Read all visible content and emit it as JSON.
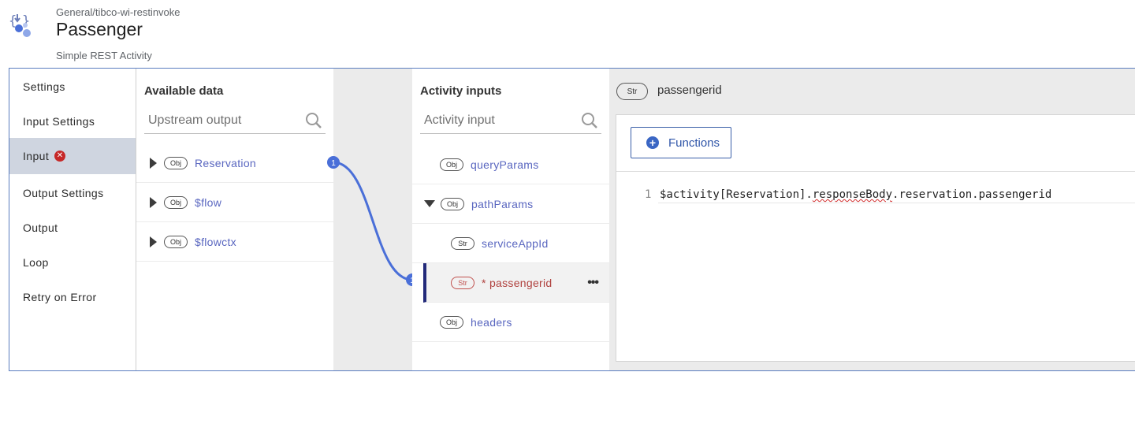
{
  "header": {
    "breadcrumb": "General/tibco-wi-restinvoke",
    "title": "Passenger",
    "subtitle": "Simple REST Activity"
  },
  "nav": {
    "items": [
      {
        "label": "Settings"
      },
      {
        "label": "Input Settings"
      },
      {
        "label": "Input",
        "has_error": true,
        "error_symbol": "✕"
      },
      {
        "label": "Output Settings"
      },
      {
        "label": "Output"
      },
      {
        "label": "Loop"
      },
      {
        "label": "Retry on Error"
      }
    ]
  },
  "available": {
    "title": "Available data",
    "search_placeholder": "Upstream output",
    "items": [
      {
        "type": "Obj",
        "label": "Reservation",
        "expandable": true
      },
      {
        "type": "Obj",
        "label": "$flow",
        "expandable": true
      },
      {
        "type": "Obj",
        "label": "$flowctx",
        "expandable": true
      }
    ]
  },
  "mapping": {
    "source_badge": "1",
    "target_badge": "1"
  },
  "inputs": {
    "title": "Activity inputs",
    "search_placeholder": "Activity input",
    "items": [
      {
        "type": "Obj",
        "label": "queryParams"
      },
      {
        "type": "Obj",
        "label": "pathParams",
        "expanded": true
      },
      {
        "type": "Str",
        "label": "serviceAppId"
      },
      {
        "type": "Str",
        "label": "* passengerid",
        "required": true,
        "selected": true
      },
      {
        "type": "Obj",
        "label": "headers"
      }
    ],
    "more_symbol": "•••"
  },
  "editor": {
    "field_type": "Str",
    "field_name": "passengerid",
    "functions_label": "Functions",
    "line_number": "1",
    "code_prefix": "$activity[Reservation].",
    "code_squiggle": "responseBody",
    "code_suffix": ".reservation.passengerid"
  },
  "colors": {
    "accent": "#3a66c4",
    "connector": "#4a6fd8",
    "error": "#c62828",
    "link_text": "#5a67c0"
  },
  "icons": {
    "app": "activity-rest-icon",
    "search": "search-icon",
    "error": "error-icon",
    "expand": "caret-right-icon",
    "collapse": "caret-down-icon",
    "add": "plus-circle-icon",
    "more": "more-icon"
  }
}
